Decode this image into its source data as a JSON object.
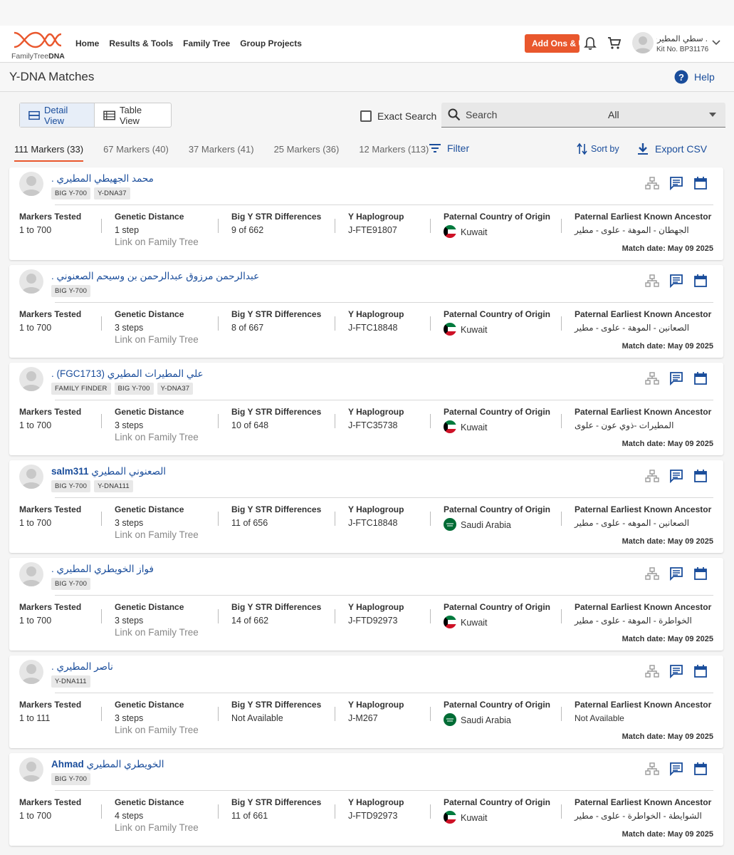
{
  "nav": {
    "logo_text_1": "FamilyTree",
    "logo_text_2": "DNA",
    "links": [
      "Home",
      "Results & Tools",
      "Family Tree",
      "Group Projects"
    ],
    "addons_label": "Add Ons & Upgrades",
    "user_name": ". سطي المطيري",
    "kit_label": "Kit No. BP31176"
  },
  "header": {
    "title": "Y-DNA Matches",
    "help_label": "Help"
  },
  "toolbar": {
    "detail_view": "Detail View",
    "table_view": "Table View",
    "exact_search": "Exact Search",
    "search_placeholder": "Search",
    "select_value": "All"
  },
  "tabs": [
    "111 Markers (33)",
    "67 Markers (40)",
    "37 Markers (41)",
    "25 Markers (36)",
    "12 Markers (113)"
  ],
  "actions": {
    "filter": "Filter",
    "sort_by": "Sort by",
    "export": "Export CSV"
  },
  "labels": {
    "markers": "Markers Tested",
    "distance": "Genetic Distance",
    "str": "Big Y STR Differences",
    "haplo": "Y Haplogroup",
    "country": "Paternal Country of Origin",
    "ancestor": "Paternal Earliest Known Ancestor",
    "link_tree": "Link on Family Tree"
  },
  "colors": {
    "link_blue": "#1a4d9b",
    "accent_orange": "#e9572d",
    "kuwait_green": "#007a3d",
    "kuwait_red": "#ce1126",
    "saudi_green": "#006c35"
  },
  "matches": [
    {
      "name_en": "",
      "name_ar": "محمد الجهيطي المطيري .",
      "badges": [
        "BIG Y-700",
        "Y-DNA37"
      ],
      "markers": "1 to 700",
      "distance": "1 step",
      "str": "9 of 662",
      "haplogroup": "J-FTE91807",
      "country": "Kuwait",
      "flag": "kuwait-flag-icon",
      "ancestor": "الجهطان - الموهة - علوى - مطير",
      "match_date": "Match date: May 09 2025"
    },
    {
      "name_en": "",
      "name_ar": "عبدالرحمن مرزوق عبدالرحمن بن وسيحم الصعنوني .",
      "badges": [
        "BIG Y-700"
      ],
      "markers": "1 to 700",
      "distance": "3 steps",
      "str": "8 of 667",
      "haplogroup": "J-FTC18848",
      "country": "Kuwait",
      "flag": "kuwait-flag-icon",
      "ancestor": "الصعانين - الموهة - علوى - مطير",
      "match_date": "Match date: May 09 2025"
    },
    {
      "name_en": "",
      "name_ar": "علي المطيرات المطيري (FGC1713) .",
      "badges": [
        "FAMILY FINDER",
        "BIG Y-700",
        "Y-DNA37"
      ],
      "markers": "1 to 700",
      "distance": "3 steps",
      "str": "10 of 648",
      "haplogroup": "J-FTC35738",
      "country": "Kuwait",
      "flag": "kuwait-flag-icon",
      "ancestor": "المطيرات -ذوي عون - علوى",
      "match_date": "Match date: May 09 2025"
    },
    {
      "name_en": "salm311",
      "name_ar": "الصعنوني المطيري",
      "badges": [
        "BIG Y-700",
        "Y-DNA111"
      ],
      "markers": "1 to 700",
      "distance": "3 steps",
      "str": "11 of 656",
      "haplogroup": "J-FTC18848",
      "country": "Saudi Arabia",
      "flag": "saudi-flag-icon",
      "ancestor": "الصعانين - الموهه - علوى - مطير",
      "match_date": "Match date: May 09 2025"
    },
    {
      "name_en": "",
      "name_ar": "فواز الخويطري المطيري .",
      "badges": [
        "BIG Y-700"
      ],
      "markers": "1 to 700",
      "distance": "3 steps",
      "str": "14 of 662",
      "haplogroup": "J-FTD92973",
      "country": "Kuwait",
      "flag": "kuwait-flag-icon",
      "ancestor": "الخواطرة - الموهة - علوى - مطير",
      "match_date": "Match date: May 09 2025"
    },
    {
      "name_en": "",
      "name_ar": "ناصر المطيري .",
      "badges": [
        "Y-DNA111"
      ],
      "markers": "1 to 111",
      "distance": "3 steps",
      "str": "Not Available",
      "haplogroup": "J-M267",
      "country": "Saudi Arabia",
      "flag": "saudi-flag-icon",
      "ancestor": "Not Available",
      "match_date": "Match date: May 09 2025"
    },
    {
      "name_en": "Ahmad",
      "name_ar": "الخويطري المطيري",
      "badges": [
        "BIG Y-700"
      ],
      "markers": "1 to 700",
      "distance": "4 steps",
      "str": "11 of 661",
      "haplogroup": "J-FTD92973",
      "country": "Kuwait",
      "flag": "kuwait-flag-icon",
      "ancestor": "الشوايطة - الخواطرة - علوى - مطير",
      "match_date": "Match date: May 09 2025"
    }
  ]
}
